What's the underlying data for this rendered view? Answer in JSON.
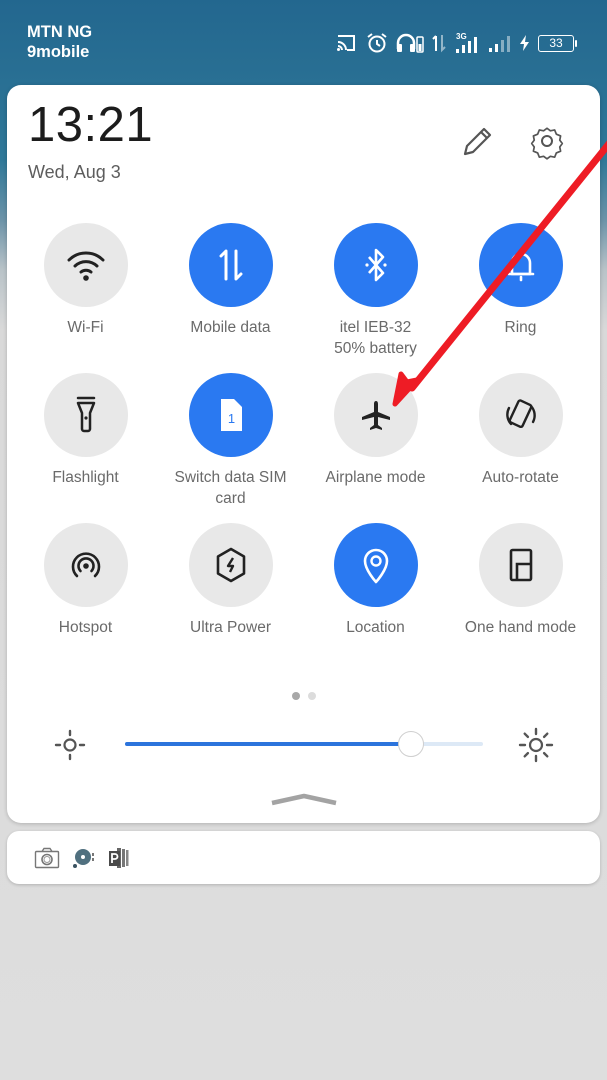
{
  "statusbar": {
    "carrier_1": "MTN NG",
    "carrier_2": "9mobile",
    "network_type": "3G",
    "battery_level": "33",
    "charging": true,
    "icons": [
      "cast-icon",
      "alarm-icon",
      "headphones-battery-icon",
      "data-activity-icon",
      "signal-sim1-icon",
      "signal-sim2-icon",
      "charging-icon",
      "battery-icon"
    ]
  },
  "panel": {
    "time": "13:21",
    "date": "Wed, Aug 3",
    "edit_icon": "pencil-icon",
    "settings_icon": "gear-icon"
  },
  "tiles": [
    {
      "id": "wifi",
      "label": "Wi-Fi",
      "sublabel": "",
      "icon": "wifi-icon",
      "active": false
    },
    {
      "id": "mobile-data",
      "label": "Mobile data",
      "sublabel": "",
      "icon": "data-arrows-icon",
      "active": true
    },
    {
      "id": "bluetooth",
      "label": "itel IEB-32",
      "sublabel": "50% battery",
      "icon": "bluetooth-icon",
      "active": true
    },
    {
      "id": "ring",
      "label": "Ring",
      "sublabel": "",
      "icon": "bell-icon",
      "active": true
    },
    {
      "id": "flashlight",
      "label": "Flashlight",
      "sublabel": "",
      "icon": "flashlight-icon",
      "active": false
    },
    {
      "id": "switch-sim",
      "label": "Switch data SIM card",
      "sublabel": "",
      "icon": "sim-card-icon",
      "sim_number": "1",
      "active": true
    },
    {
      "id": "airplane",
      "label": "Airplane mode",
      "sublabel": "",
      "icon": "airplane-icon",
      "active": false
    },
    {
      "id": "auto-rotate",
      "label": "Auto-rotate",
      "sublabel": "",
      "icon": "rotate-icon",
      "active": false
    },
    {
      "id": "hotspot",
      "label": "Hotspot",
      "sublabel": "",
      "icon": "hotspot-icon",
      "active": false
    },
    {
      "id": "ultra-power",
      "label": "Ultra Power",
      "sublabel": "",
      "icon": "power-saver-icon",
      "active": false
    },
    {
      "id": "location",
      "label": "Location",
      "sublabel": "",
      "icon": "location-pin-icon",
      "active": true
    },
    {
      "id": "one-hand",
      "label": "One hand mode",
      "sublabel": "",
      "icon": "one-hand-icon",
      "active": false
    }
  ],
  "pager": {
    "pages": 2,
    "current": 1
  },
  "brightness": {
    "value_percent": 80
  },
  "notifications": {
    "icons": [
      "camera-icon",
      "music-player-icon",
      "powerpoint-icon"
    ]
  },
  "colors": {
    "accent": "#2a79f1",
    "tile_off": "#e8e8e8",
    "annotation_arrow": "#ee1c25"
  }
}
